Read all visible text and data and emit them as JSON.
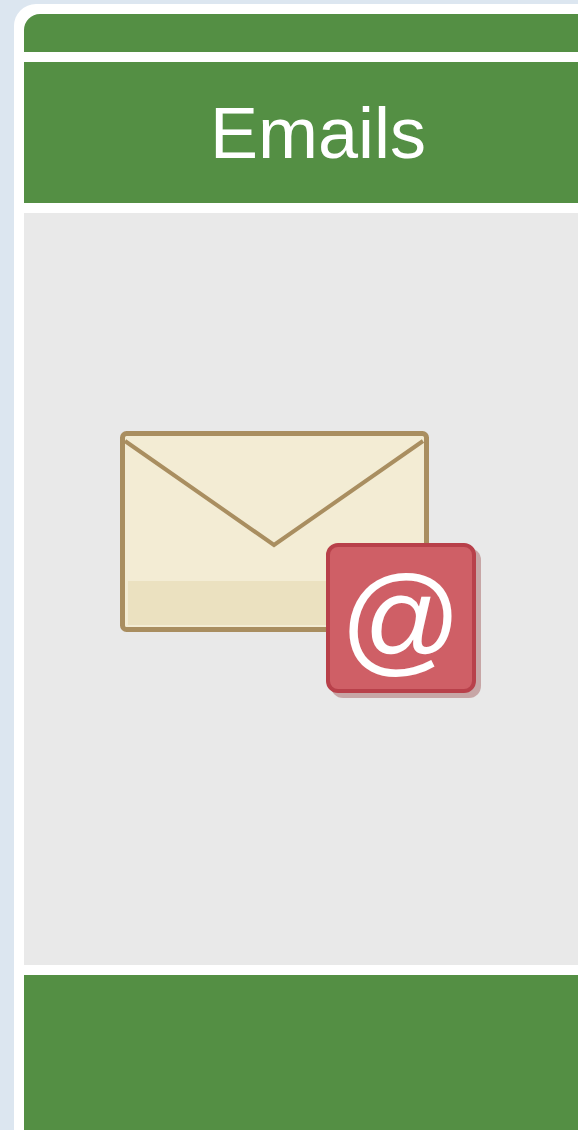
{
  "panel": {
    "title": "Emails",
    "icon_badge": "@"
  }
}
